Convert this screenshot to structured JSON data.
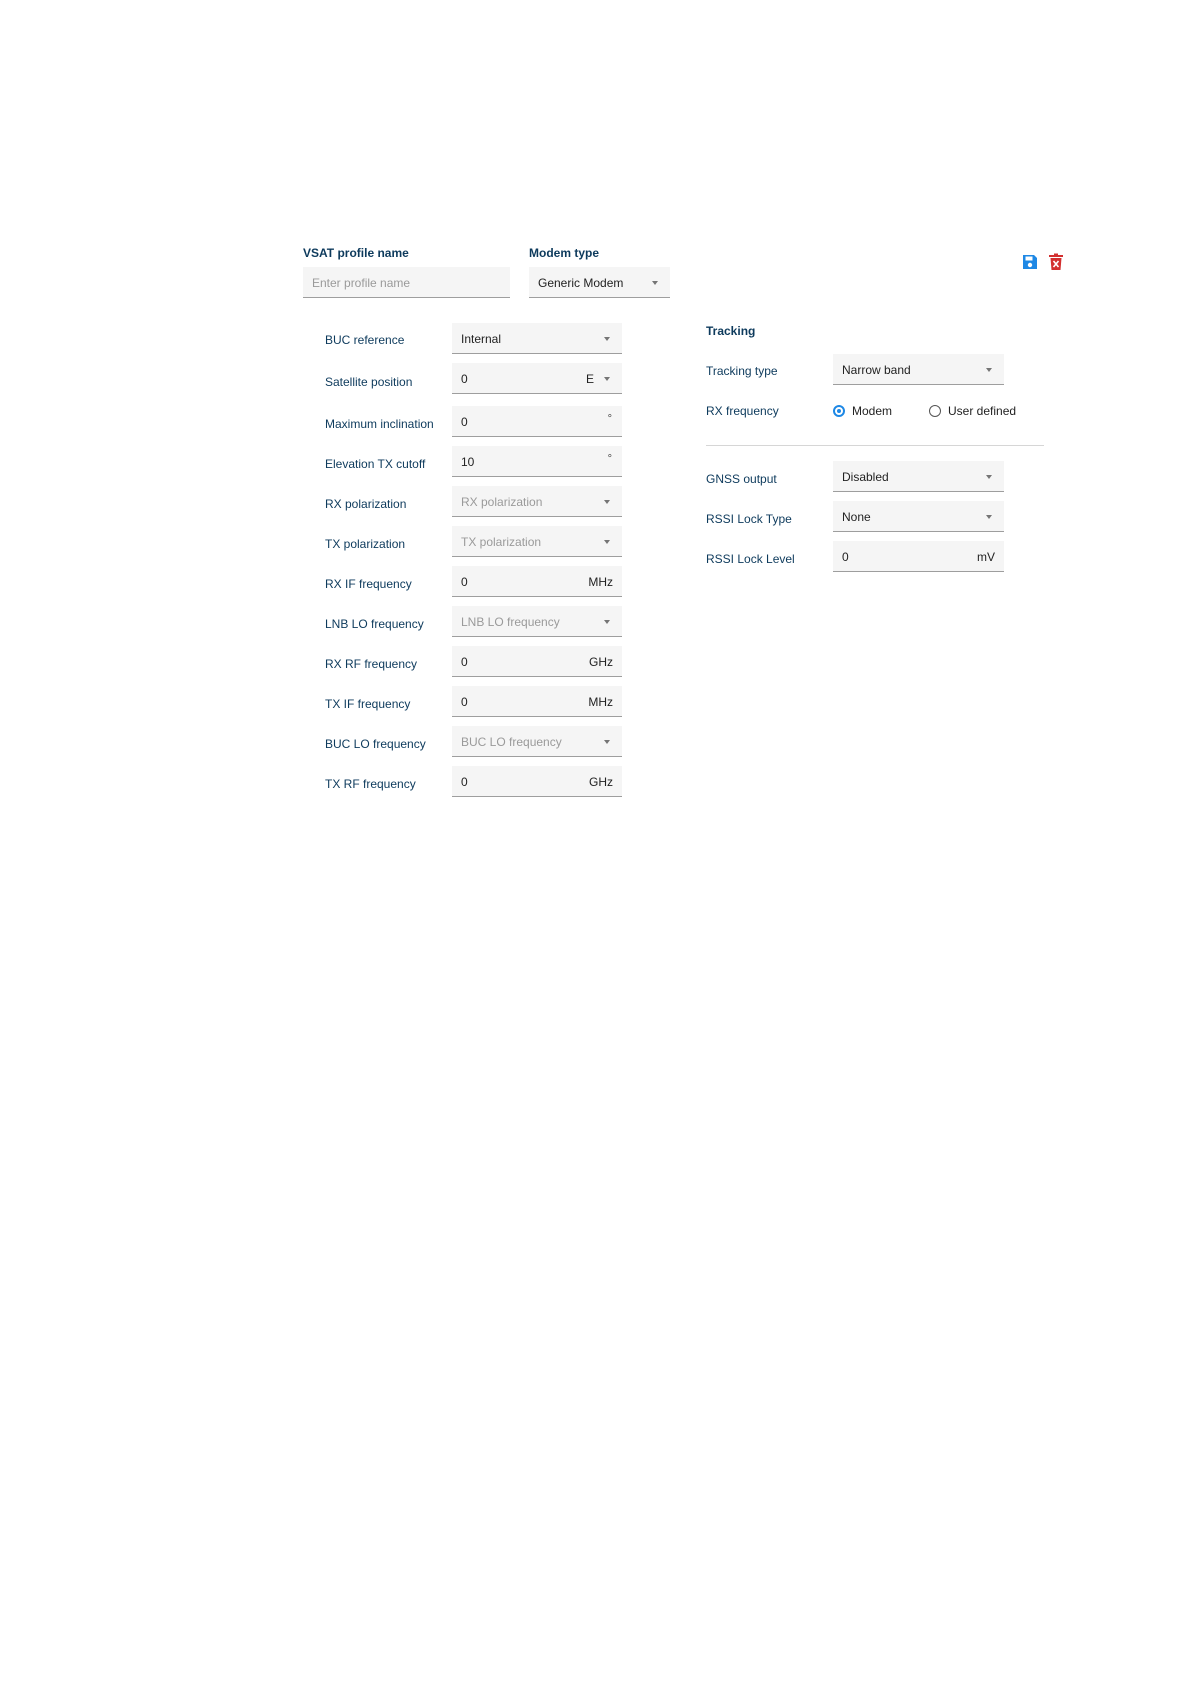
{
  "header": {
    "profile_name_label": "VSAT profile name",
    "profile_name_placeholder": "Enter profile name",
    "modem_type_label": "Modem type",
    "modem_type_value": "Generic Modem"
  },
  "toolbar": {
    "save_icon": "save-icon",
    "delete_icon": "delete-icon",
    "save_color": "#1e88e5",
    "delete_color": "#d32f2f"
  },
  "left_form": {
    "buc_reference": {
      "label": "BUC reference",
      "value": "Internal"
    },
    "satellite_position": {
      "label": "Satellite position",
      "value": "0",
      "unit": "E"
    },
    "maximum_inclination": {
      "label": "Maximum inclination",
      "value": "0",
      "unit": "°"
    },
    "elevation_tx_cutoff": {
      "label": "Elevation TX cutoff",
      "value": "10",
      "unit": "°"
    },
    "rx_polarization": {
      "label": "RX polarization",
      "placeholder": "RX polarization"
    },
    "tx_polarization": {
      "label": "TX polarization",
      "placeholder": "TX polarization"
    },
    "rx_if_frequency": {
      "label": "RX IF frequency",
      "value": "0",
      "unit": "MHz"
    },
    "lnb_lo_frequency": {
      "label": "LNB LO frequency",
      "placeholder": "LNB LO frequency"
    },
    "rx_rf_frequency": {
      "label": "RX RF frequency",
      "value": "0",
      "unit": "GHz"
    },
    "tx_if_frequency": {
      "label": "TX IF frequency",
      "value": "0",
      "unit": "MHz"
    },
    "buc_lo_frequency": {
      "label": "BUC LO frequency",
      "placeholder": "BUC LO frequency"
    },
    "tx_rf_frequency": {
      "label": "TX RF frequency",
      "value": "0",
      "unit": "GHz"
    }
  },
  "tracking": {
    "title": "Tracking",
    "tracking_type": {
      "label": "Tracking type",
      "value": "Narrow band"
    },
    "rx_frequency": {
      "label": "RX frequency",
      "option_modem": "Modem",
      "option_user": "User defined",
      "selected": "Modem"
    },
    "gnss_output": {
      "label": "GNSS output",
      "value": "Disabled"
    },
    "rssi_lock_type": {
      "label": "RSSI Lock Type",
      "value": "None"
    },
    "rssi_lock_level": {
      "label": "RSSI Lock Level",
      "value": "0",
      "unit": "mV"
    }
  }
}
